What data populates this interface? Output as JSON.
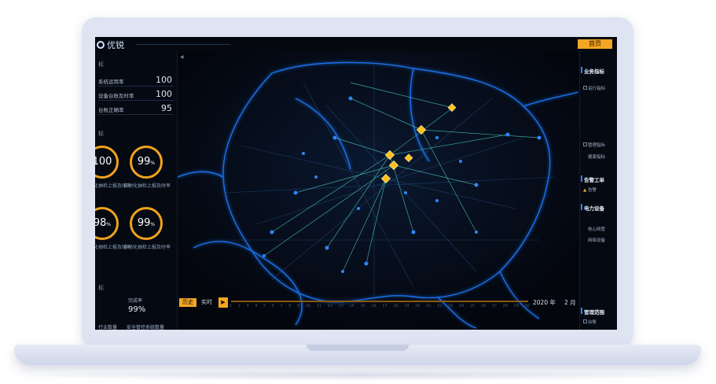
{
  "brand": {
    "name": "优锐"
  },
  "header": {
    "home_label": "首页"
  },
  "left_panel": {
    "section_title_1": "标",
    "metrics": [
      {
        "label": "系统运用率",
        "value": "100"
      },
      {
        "label": "设备台账及时率",
        "value": "100"
      },
      {
        "label": "台账正确率",
        "value": "95"
      }
    ],
    "section_title_2": "标",
    "rings": [
      {
        "value": "100",
        "unit": "",
        "caption": "自动化抽检上报及时率"
      },
      {
        "value": "99",
        "unit": "%",
        "caption": "自动化抽检上报及时率"
      },
      {
        "value": "98",
        "unit": "%",
        "caption": "自动化抽检上报及时率"
      },
      {
        "value": "99",
        "unit": "%",
        "caption": "自动化抽检上报及时率"
      }
    ],
    "section_title_3": "标",
    "bottom": {
      "label_a": "完成率",
      "value_a": "99%",
      "label_b": "行业数量",
      "label_c": "安全管控系统数量"
    }
  },
  "right_panel": {
    "section1": "业务指标",
    "item1": "运行指标",
    "item2": "管理指标",
    "item3": "健康指标",
    "section2": "告警工单",
    "alarm_item": "告警",
    "section3": "电力设备",
    "equip_item1": "核心网管",
    "equip_item2": "网络设备",
    "section4": "管理范围",
    "mgmt_item": "台账"
  },
  "timeline": {
    "history_label": "历史",
    "realtime_label": "实时",
    "play_icon": "play-icon",
    "ticks": [
      "1",
      "2",
      "3",
      "4",
      "5",
      "6",
      "7",
      "8",
      "9",
      "10",
      "11",
      "12",
      "13",
      "14",
      "15",
      "16",
      "17",
      "18",
      "19",
      "20",
      "21",
      "22",
      "23",
      "24",
      "25",
      "26",
      "27",
      "28",
      "29",
      "30"
    ],
    "year": "2020 年",
    "month": "2 月"
  },
  "colors": {
    "accent": "#f5a623",
    "node_blue": "#2f86ff",
    "map_glow": "#1f7bff",
    "panel_bg": "#050912"
  }
}
